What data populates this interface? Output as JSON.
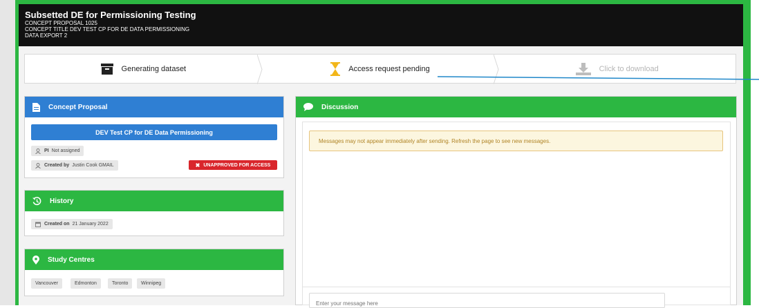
{
  "header": {
    "title": "Subsetted DE for Permissioning Testing",
    "line1": "CONCEPT PROPOSAL 1025",
    "line2": "CONCEPT TITLE DEV TEST CP FOR DE DATA PERMISSIONING",
    "line3": "DATA EXPORT 2"
  },
  "stepper": {
    "steps": [
      {
        "label": "Generating dataset",
        "icon": "archive-icon",
        "state": "done"
      },
      {
        "label": "Access request pending",
        "icon": "hourglass-icon",
        "state": "active"
      },
      {
        "label": "Click to download",
        "icon": "download-icon",
        "state": "disabled"
      }
    ]
  },
  "concept_proposal": {
    "heading": "Concept Proposal",
    "button_label": "DEV Test CP for DE Data Permissioning",
    "pi_label": "PI",
    "pi_value": "Not assigned",
    "created_by_label": "Created by",
    "created_by_value": "Justin Cook GMAIL",
    "status_badge": "UNAPPROVED FOR ACCESS"
  },
  "history": {
    "heading": "History",
    "created_on_label": "Created on",
    "created_on_value": "21 January 2022"
  },
  "study_centres": {
    "heading": "Study Centres",
    "items": [
      "Vancouver",
      "Edmonton",
      "Toronto",
      "Winnipeg"
    ]
  },
  "discussion": {
    "heading": "Discussion",
    "notice": "Messages may not appear immediately after sending. Refresh the page to see new messages.",
    "input_placeholder": "Enter your message here"
  },
  "colors": {
    "frame_green": "#2cb742",
    "card_blue": "#2f7fd3",
    "badge_red": "#d9262c",
    "notice_bg": "#fcf6df",
    "notice_text": "#b08426",
    "hourglass_gold": "#f2b619",
    "annotation_line": "#1f87c9"
  }
}
